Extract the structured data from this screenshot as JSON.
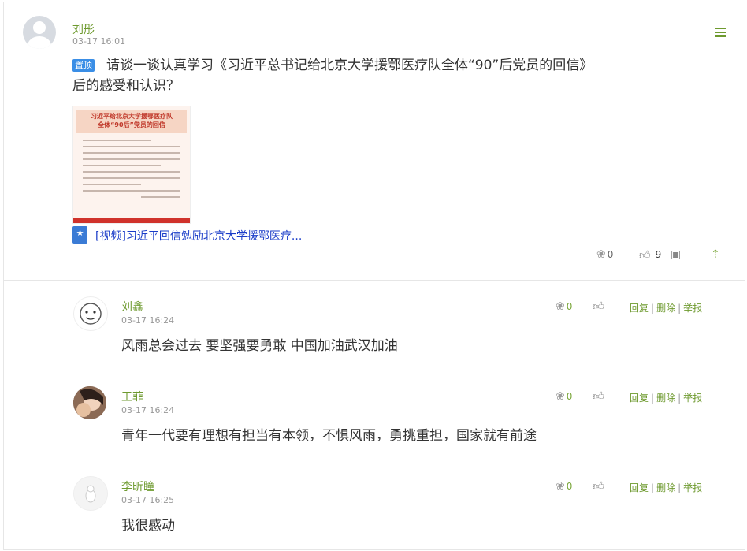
{
  "post": {
    "author": "刘彤",
    "time": "03-17 16:01",
    "pin_badge": "置顶",
    "title_line1": "请谈一谈认真学习《习近平总书记给北京大学援鄂医疗队全体“90”后党员的回信》",
    "title_line2": "后的感受和认识？",
    "thumb_title1": "习近平给北京大学援鄂医疗队",
    "thumb_title2": "全体“90后”党员的回信",
    "video_link": "[视频]习近平回信勉励北京大学援鄂医疗...",
    "flower_count": "0",
    "like_count": "9"
  },
  "comments": [
    {
      "name": "刘鑫",
      "time": "03-17 16:24",
      "text": "风雨总会过去  要坚强要勇敢   中国加油武汉加油",
      "flower_count": "0"
    },
    {
      "name": "王菲",
      "time": "03-17 16:24",
      "text": "青年一代要有理想有担当有本领，不惧风雨，勇挑重担，国家就有前途",
      "flower_count": "0"
    },
    {
      "name": "李昕瞳",
      "time": "03-17 16:25",
      "text": "我很感动",
      "flower_count": "0"
    }
  ],
  "comment_links": {
    "reply": "回复",
    "delete": "删除",
    "report": "举报"
  },
  "colors": {
    "accent_green": "#6e9a2f",
    "link_blue": "#1a3cc8",
    "badge_blue": "#3a8ee6"
  }
}
